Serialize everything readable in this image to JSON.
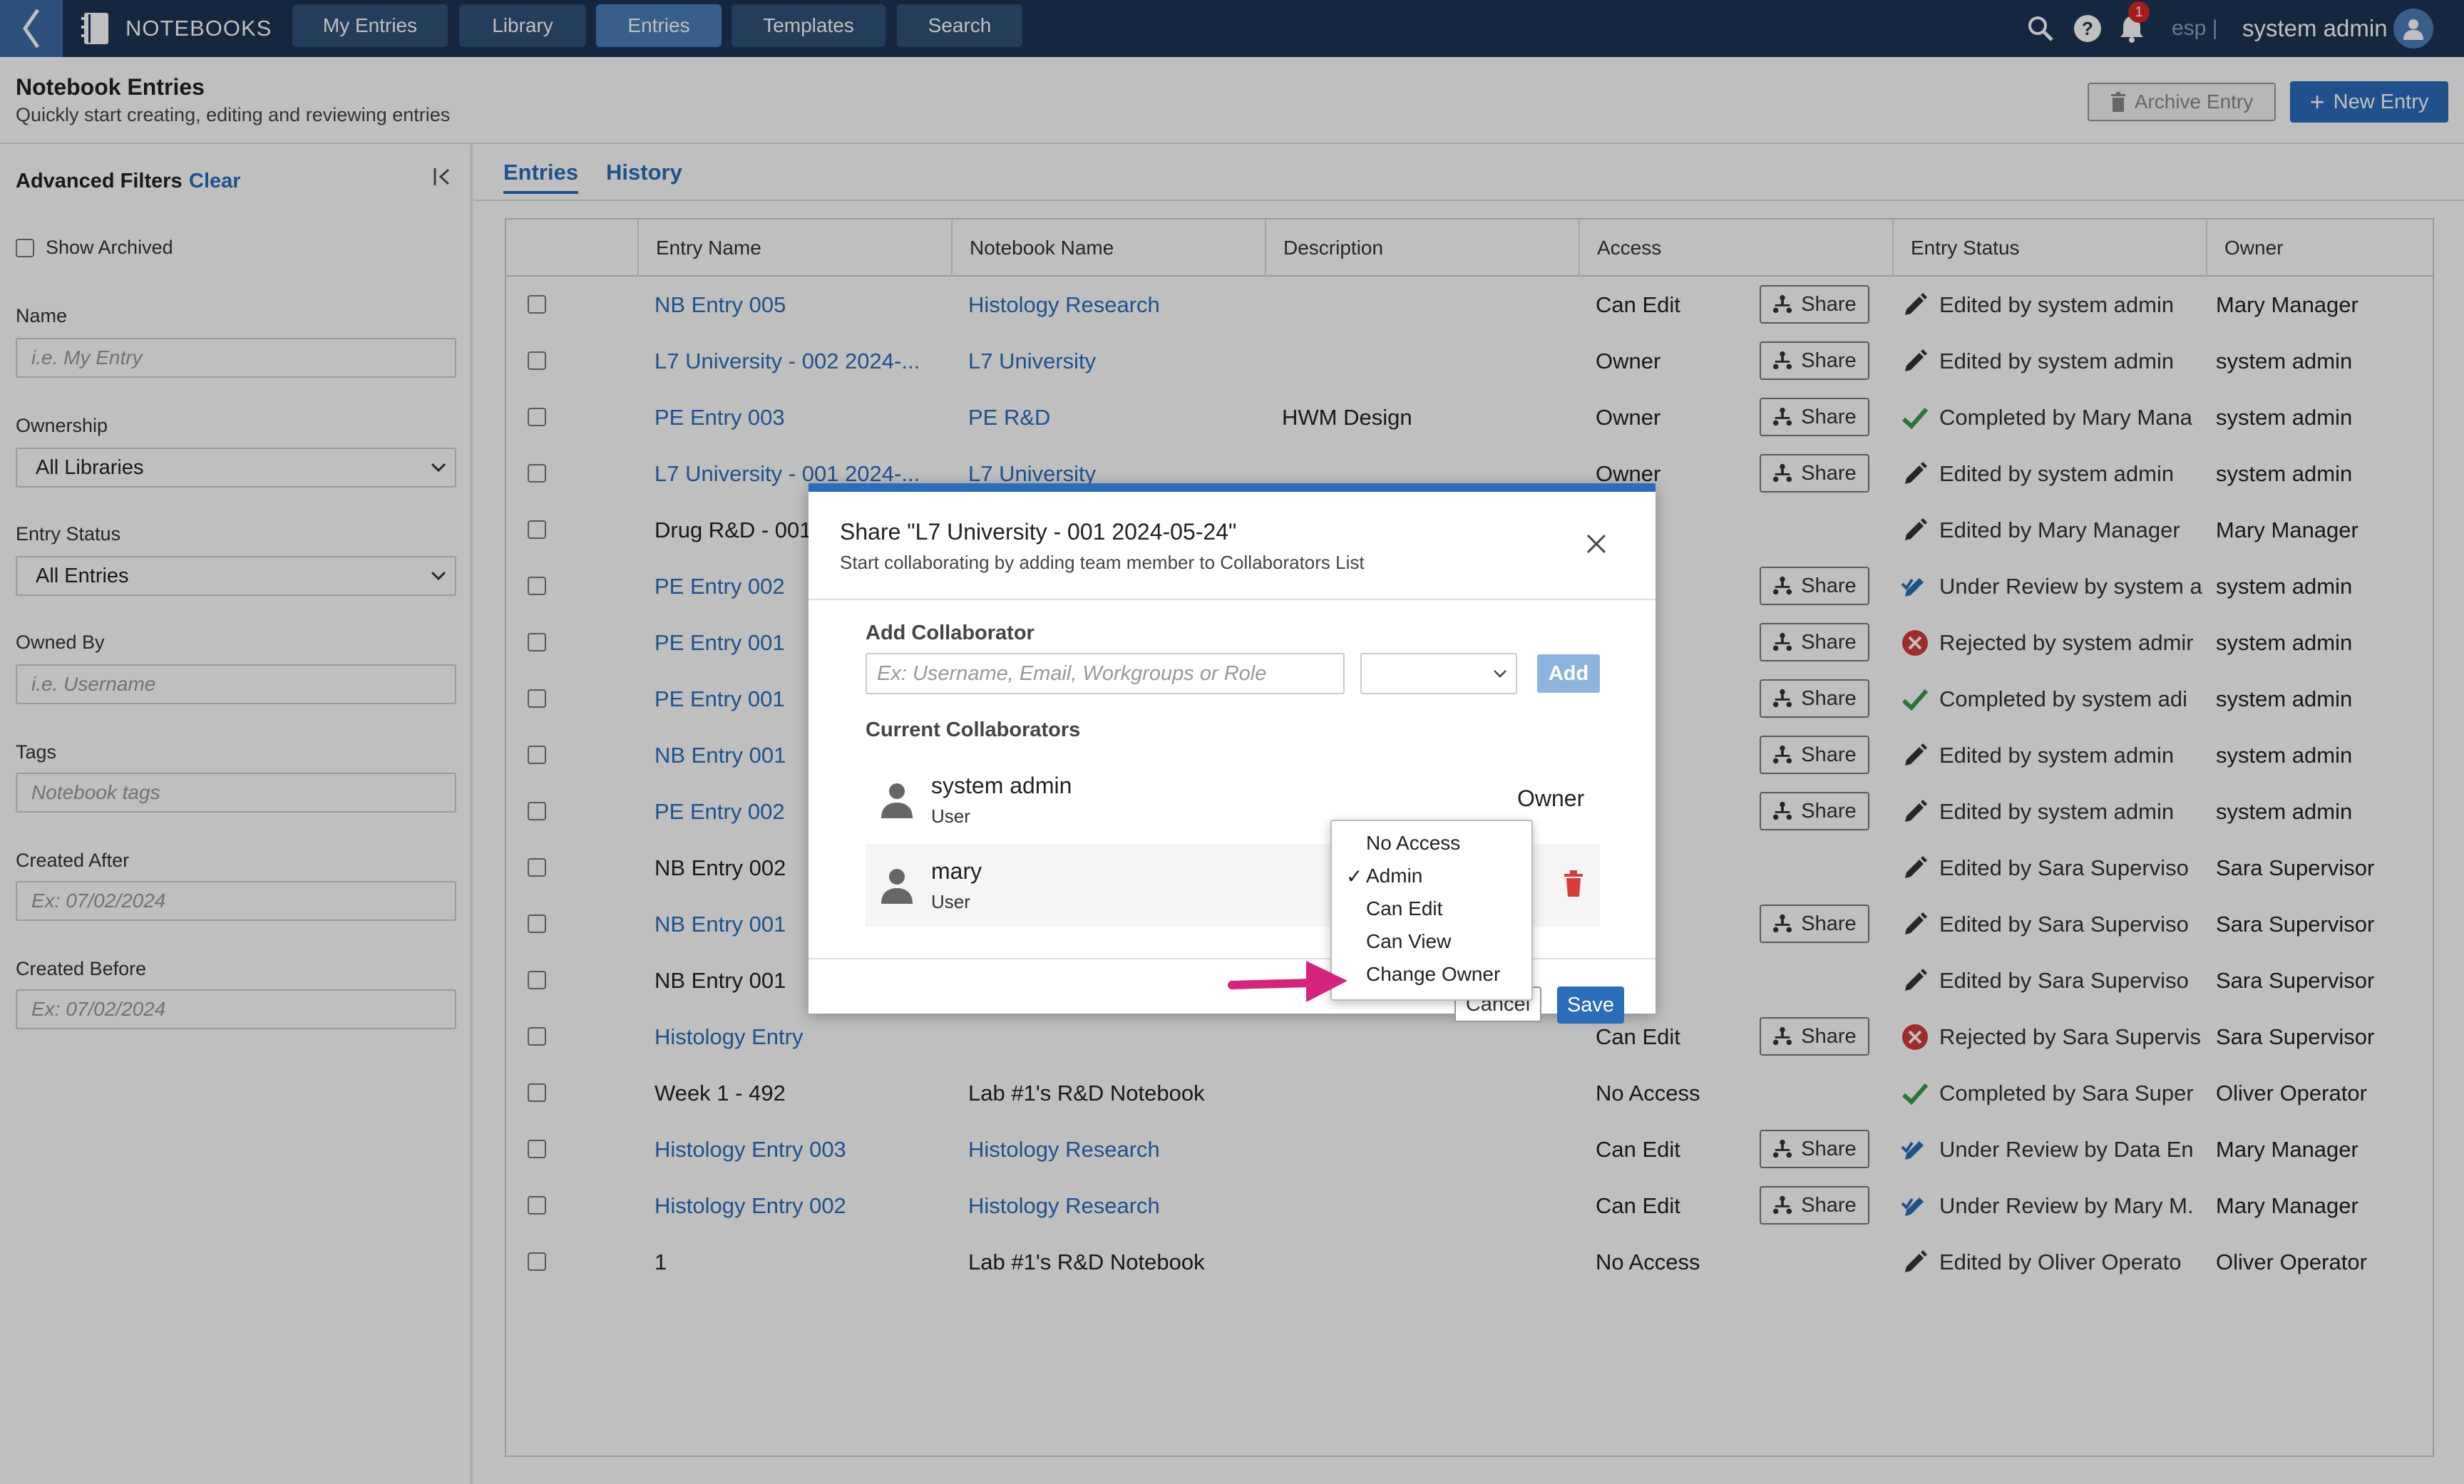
{
  "topbar": {
    "brand": "NOTEBOOKS",
    "nav": [
      "My Entries",
      "Library",
      "Entries",
      "Templates",
      "Search"
    ],
    "active_nav": "Entries",
    "notification_count": "1",
    "language": "esp |",
    "username": "system admin",
    "colors": {
      "bar": "#1c3553",
      "active": "#4a7fb8"
    }
  },
  "header": {
    "title": "Notebook Entries",
    "subtitle": "Quickly start creating, editing and reviewing entries",
    "archive_label": "Archive Entry",
    "new_label": "New Entry"
  },
  "sidebar": {
    "title": "Advanced Filters",
    "clear": "Clear",
    "show_archived": "Show Archived",
    "name_label": "Name",
    "name_placeholder": "i.e. My Entry",
    "ownership_label": "Ownership",
    "ownership_value": "All Libraries",
    "status_label": "Entry Status",
    "status_value": "All Entries",
    "owned_by_label": "Owned By",
    "owned_by_placeholder": "i.e. Username",
    "tags_label": "Tags",
    "tags_placeholder": "Notebook tags",
    "created_after_label": "Created After",
    "created_after_placeholder": "Ex: 07/02/2024",
    "created_before_label": "Created Before",
    "created_before_placeholder": "Ex: 07/02/2024"
  },
  "main": {
    "tabs": [
      "Entries",
      "History"
    ],
    "active_tab": "Entries",
    "columns": [
      "Entry Name",
      "Notebook Name",
      "Description",
      "Access",
      "Entry Status",
      "Owner"
    ],
    "share_label": "Share",
    "rows": [
      {
        "entry": "NB Entry 005",
        "entry_link": true,
        "notebook": "Histology Research",
        "notebook_link": true,
        "description": "",
        "access": "Can Edit",
        "share": true,
        "status_icon": "pencil",
        "status": "Edited by system admin",
        "owner": "Mary Manager"
      },
      {
        "entry": "L7 University - 002 2024-...",
        "entry_link": true,
        "notebook": "L7 University",
        "notebook_link": true,
        "description": "",
        "access": "Owner",
        "share": true,
        "status_icon": "pencil",
        "status": "Edited by system admin",
        "owner": "system admin"
      },
      {
        "entry": "PE Entry 003",
        "entry_link": true,
        "notebook": "PE R&D",
        "notebook_link": true,
        "description": "HWM Design",
        "access": "Owner",
        "share": true,
        "status_icon": "check",
        "status": "Completed by Mary Mana",
        "owner": "system admin"
      },
      {
        "entry": "L7 University - 001 2024-...",
        "entry_link": true,
        "notebook": "L7 University",
        "notebook_link": true,
        "description": "",
        "access": "Owner",
        "share": true,
        "status_icon": "pencil",
        "status": "Edited by system admin",
        "owner": "system admin"
      },
      {
        "entry": "Drug R&D - 001",
        "entry_link": false,
        "notebook": "",
        "notebook_link": false,
        "description": "",
        "access": "ccess",
        "share": false,
        "status_icon": "pencil",
        "status": "Edited by Mary Manager",
        "owner": "Mary Manager"
      },
      {
        "entry": "PE Entry 002",
        "entry_link": true,
        "notebook": "",
        "notebook_link": true,
        "description": "",
        "access": "r",
        "share": true,
        "status_icon": "review",
        "status": "Under Review by system a",
        "owner": "system admin"
      },
      {
        "entry": "PE Entry 001",
        "entry_link": true,
        "notebook": "",
        "notebook_link": true,
        "description": "",
        "access": "r",
        "share": true,
        "status_icon": "reject",
        "status": "Rejected by system admir",
        "owner": "system admin"
      },
      {
        "entry": "PE Entry 001",
        "entry_link": true,
        "notebook": "",
        "notebook_link": true,
        "description": "",
        "access": "r",
        "share": true,
        "status_icon": "check",
        "status": "Completed by system adi",
        "owner": "system admin"
      },
      {
        "entry": "NB Entry 001",
        "entry_link": true,
        "notebook": "",
        "notebook_link": true,
        "description": "",
        "access": "r",
        "share": true,
        "status_icon": "pencil",
        "status": "Edited by system admin",
        "owner": "system admin"
      },
      {
        "entry": "PE Entry 002",
        "entry_link": true,
        "notebook": "",
        "notebook_link": true,
        "description": "",
        "access": "r",
        "share": true,
        "status_icon": "pencil",
        "status": "Edited by system admin",
        "owner": "system admin"
      },
      {
        "entry": "NB Entry 002",
        "entry_link": false,
        "notebook": "",
        "notebook_link": false,
        "description": "",
        "access": "ccess",
        "share": false,
        "status_icon": "pencil",
        "status": "Edited by Sara Superviso",
        "owner": "Sara Supervisor"
      },
      {
        "entry": "NB Entry 001",
        "entry_link": true,
        "notebook": "",
        "notebook_link": true,
        "description": "",
        "access": "dit",
        "share": true,
        "status_icon": "pencil",
        "status": "Edited by Sara Superviso",
        "owner": "Sara Supervisor"
      },
      {
        "entry": "NB Entry 001",
        "entry_link": false,
        "notebook": "",
        "notebook_link": false,
        "description": "",
        "access": "ccess",
        "share": false,
        "status_icon": "pencil",
        "status": "Edited by Sara Superviso",
        "owner": "Sara Supervisor"
      },
      {
        "entry": "Histology Entry",
        "entry_link": true,
        "notebook": "",
        "notebook_link": true,
        "description": "",
        "access": "Can Edit",
        "share": true,
        "status_icon": "reject",
        "status": "Rejected by Sara Supervis",
        "owner": "Sara Supervisor"
      },
      {
        "entry": "Week 1 - 492",
        "entry_link": false,
        "notebook": "Lab #1's R&D Notebook",
        "notebook_link": false,
        "description": "",
        "access": "No Access",
        "share": false,
        "status_icon": "check",
        "status": "Completed by Sara Super",
        "owner": "Oliver Operator"
      },
      {
        "entry": "Histology Entry 003",
        "entry_link": true,
        "notebook": "Histology Research",
        "notebook_link": true,
        "description": "",
        "access": "Can Edit",
        "share": true,
        "status_icon": "review",
        "status": "Under Review by Data En",
        "owner": "Mary Manager"
      },
      {
        "entry": "Histology Entry 002",
        "entry_link": true,
        "notebook": "Histology Research",
        "notebook_link": true,
        "description": "",
        "access": "Can Edit",
        "share": true,
        "status_icon": "review",
        "status": "Under Review by Mary M.",
        "owner": "Mary Manager"
      },
      {
        "entry": "1",
        "entry_link": false,
        "notebook": "Lab #1's R&D Notebook",
        "notebook_link": false,
        "description": "",
        "access": "No Access",
        "share": false,
        "status_icon": "pencil",
        "status": "Edited by Oliver Operato",
        "owner": "Oliver Operator"
      }
    ]
  },
  "modal": {
    "title": "Share \"L7 University - 001 2024-05-24\"",
    "subtitle": "Start collaborating by adding team member to Collaborators List",
    "add_label": "Add Collaborator",
    "add_placeholder": "Ex: Username, Email, Workgroups or Role",
    "add_button": "Add",
    "current_label": "Current Collaborators",
    "collaborators": [
      {
        "name": "system admin",
        "type": "User",
        "role": "Owner"
      },
      {
        "name": "mary",
        "type": "User",
        "role": "Admin"
      }
    ],
    "cancel_label": "Cancel",
    "save_label": "Save"
  },
  "dropdown": {
    "options": [
      "No Access",
      "Admin",
      "Can Edit",
      "Can View",
      "Change Owner"
    ],
    "selected": "Admin"
  },
  "annotation_color": "#d6247a"
}
